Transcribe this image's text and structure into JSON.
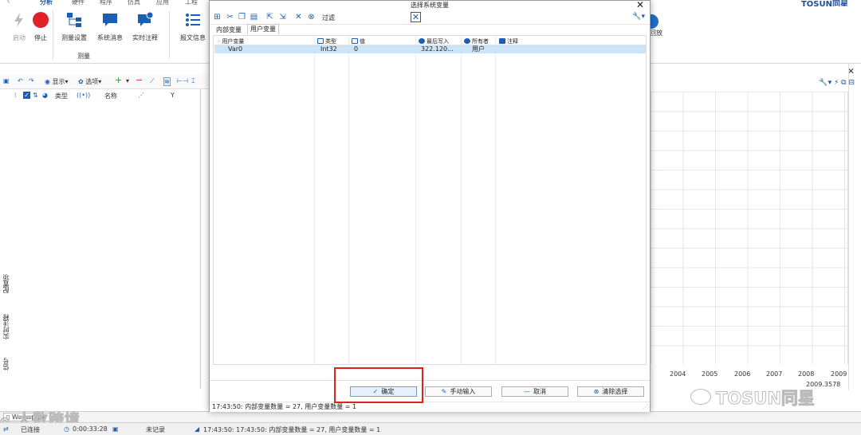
{
  "ribbon_tabs": [
    {
      "label": "分析",
      "active": true
    },
    {
      "label": "硬件",
      "active": false
    },
    {
      "label": "程序",
      "active": false
    },
    {
      "label": "仿真",
      "active": false
    },
    {
      "label": "应用",
      "active": false
    },
    {
      "label": "工程",
      "active": false
    }
  ],
  "brand": "TOSUN同星",
  "ribbon": {
    "start": "启动",
    "stop": "停止",
    "measure_setup": "测量设置",
    "system_messages": "系统消息",
    "realtime_comment": "实时注释",
    "message_info": "报文信息",
    "group_label": "测量",
    "playback": "回放"
  },
  "left_toolbar": {
    "display": "显示",
    "options": "选项"
  },
  "left_columns": {
    "type": "类型",
    "name": "名称",
    "y": "Y"
  },
  "left_vtabs": [
    "配置项",
    "实时注释",
    "信号"
  ],
  "graph": {
    "x_ticks": [
      "2004",
      "2005",
      "2006",
      "2007",
      "2008",
      "2009"
    ],
    "readout": "2009.3578"
  },
  "dialog": {
    "title": "选择系统变量",
    "filter_label": "过滤",
    "tabs": [
      "内部变量",
      "用户变量"
    ],
    "selected_tab": 1,
    "columns": {
      "name": "用户变量",
      "type": "类型",
      "value": "值",
      "last_write": "最后写入",
      "owner": "所有者",
      "comment": "注释"
    },
    "rows": [
      {
        "name": "Var0",
        "type": "Int32",
        "value": "0",
        "last_write": "322.120...",
        "owner": "用户",
        "comment": ""
      }
    ],
    "buttons": {
      "ok": "确定",
      "manual_input": "手动输入",
      "cancel": "取消",
      "clear_selection": "清除选择"
    },
    "status": "17:43:50: 内部变量数量 = 27, 用户变量数量 = 1"
  },
  "workspace_tab": "Workspace",
  "watermarks": {
    "left": "大数跨境",
    "right": "TOSUN同星"
  },
  "statusbar": {
    "connection": "已连接",
    "elapsed": "0:00:33:28",
    "record": "未记录",
    "log": "17:43:50: 17:43:50: 内部变量数量 = 27, 用户变量数量 = 1"
  },
  "colors": {
    "accent": "#1a5fb4",
    "highlight": "#e02020",
    "row_selected": "#cce4f7",
    "stop_red": "#e0202a"
  }
}
